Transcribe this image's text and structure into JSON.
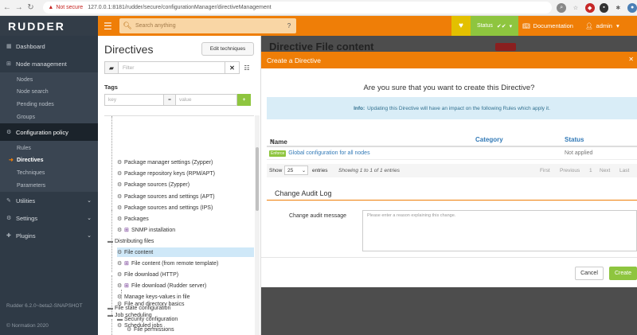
{
  "browser": {
    "not_secure": "Not secure",
    "url": "127.0.0.1:8181/rudder/secure/configurationManager/directiveManagement"
  },
  "topbar": {
    "logo": "RUDDER",
    "search_placeholder": "Search anything",
    "status_label": "Status",
    "documentation": "Documentation",
    "user": "admin",
    "accent_color": "#ef7e07"
  },
  "sidebar": {
    "items": [
      {
        "label": "Dashboard",
        "icon": "dashboard-icon"
      },
      {
        "label": "Node management",
        "icon": "sitemap-icon"
      },
      {
        "label": "Configuration policy",
        "icon": "gear-icon"
      },
      {
        "label": "Utilities",
        "icon": "wrench-icon"
      },
      {
        "label": "Settings",
        "icon": "gear-icon"
      },
      {
        "label": "Plugins",
        "icon": "puzzle-icon"
      }
    ],
    "node_sub": [
      "Nodes",
      "Node search",
      "Pending nodes",
      "Groups"
    ],
    "config_sub": [
      "Rules",
      "Directives",
      "Techniques",
      "Parameters"
    ],
    "version": "Rudder 6.2.0~beta2-SNAPSHOT",
    "copyright": "© Normation 2020"
  },
  "directives": {
    "title": "Directives",
    "edit_techniques": "Edit techniques",
    "filter_placeholder": "Filter",
    "tags_label": "Tags",
    "key_placeholder": "key",
    "equals": "=",
    "value_placeholder": "value",
    "tree": [
      {
        "label": "Package manager settings (Zypper)",
        "kind": "technique"
      },
      {
        "label": "Package repository keys (RPM/APT)",
        "kind": "technique"
      },
      {
        "label": "Package sources (Zypper)",
        "kind": "technique"
      },
      {
        "label": "Package sources and settings (APT)",
        "kind": "technique"
      },
      {
        "label": "Package sources and settings (IPS)",
        "kind": "technique"
      },
      {
        "label": "Packages",
        "kind": "technique"
      },
      {
        "label": "SNMP installation",
        "kind": "windows"
      },
      {
        "label": "Distributing files",
        "kind": "folder"
      },
      {
        "label": "File content",
        "kind": "technique"
      },
      {
        "label": "File content (from remote template)",
        "kind": "windows"
      },
      {
        "label": "File download (HTTP)",
        "kind": "technique"
      },
      {
        "label": "File download (Rudder server)",
        "kind": "windows"
      },
      {
        "label": "Manage keys-values in file",
        "kind": "technique"
      },
      {
        "label": "File state configuration",
        "kind": "folder"
      },
      {
        "label": "Security configuration",
        "kind": "folder"
      },
      {
        "label": "File permissions",
        "kind": "technique"
      },
      {
        "label": "File and directory basics",
        "kind": "technique"
      },
      {
        "label": "Job scheduling",
        "kind": "folder"
      },
      {
        "label": "Scheduled jobs",
        "kind": "technique"
      }
    ]
  },
  "background": {
    "title": "Directive File content"
  },
  "modal": {
    "title": "Create a Directive",
    "question": "Are you sure that you want to create this Directive?",
    "info_bold": "Info:",
    "info_text": "Updating this Directive will have an impact on the following Rules which apply it.",
    "columns": [
      "Name",
      "Category",
      "Status"
    ],
    "row": {
      "badge": "Enforce",
      "name": "Global configuration for all nodes",
      "category": "",
      "status": "Not applied"
    },
    "show_label": "Show",
    "page_size": "25",
    "entries_label": "entries",
    "showing": "Showing 1 to 1 of 1 entries",
    "pager": [
      "First",
      "Previous",
      "1",
      "Next",
      "Last"
    ],
    "audit_title": "Change Audit Log",
    "audit_label": "Change audit message",
    "audit_placeholder": "Please enter a reason explaining this change.",
    "cancel": "Cancel",
    "create": "Create"
  }
}
